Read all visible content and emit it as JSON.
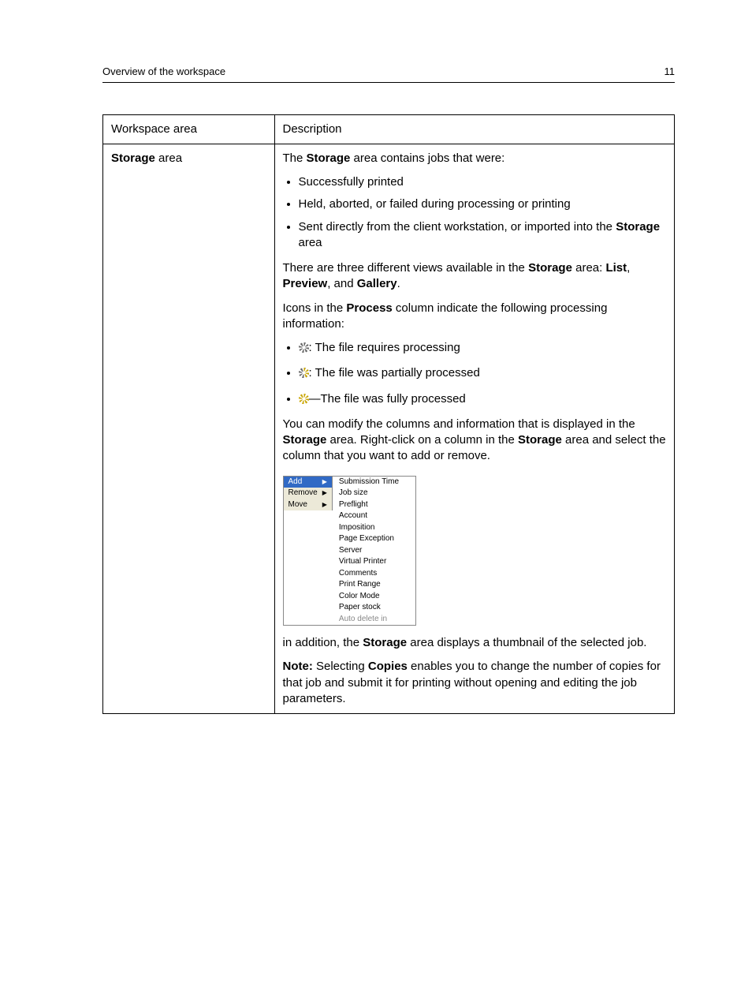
{
  "header": {
    "title": "Overview of the workspace",
    "page_no": "11"
  },
  "table": {
    "head": {
      "c1": "Workspace area",
      "c2": "Description"
    },
    "ws_label_bold": "Storage",
    "ws_label_rest": " area",
    "intro_a": "The ",
    "intro_b": "Storage",
    "intro_c": " area contains jobs that were:",
    "bul1": "Successfully printed",
    "bul2": "Held, aborted, or failed during processing or printing",
    "bul3_a": "Sent directly from the client workstation, or imported into the ",
    "bul3_b": "Storage",
    "bul3_c": " area",
    "views_a": "There are three different views available in the ",
    "views_b": "Storage",
    "views_c": " area: ",
    "views_d": "List",
    "views_e": ", ",
    "views_f": "Preview",
    "views_g": ", and ",
    "views_h": "Gallery",
    "views_i": ".",
    "proc_a": "Icons in the ",
    "proc_b": "Process",
    "proc_c": " column indicate the following processing information:",
    "ic1": ": The file requires processing",
    "ic2": ": The file was partially processed",
    "ic3": "—The file was fully processed",
    "mod_a": "You can modify the columns and information that is displayed in the ",
    "mod_b": "Storage",
    "mod_c": " area. Right-click on a column in the ",
    "mod_d": "Storage",
    "mod_e": " area and select the column that you want to add or remove.",
    "addl_a": "in addition, the ",
    "addl_b": "Storage",
    "addl_c": " area displays a thumbnail of the selected job.",
    "note_a": "Note:",
    "note_b": " Selecting ",
    "note_c": "Copies",
    "note_d": " enables you to change the number of copies for that job and submit it for printing without opening and editing the job parameters."
  },
  "menu": {
    "left": [
      "Add",
      "Remove",
      "Move"
    ],
    "right": [
      "Submission Time",
      "Job size",
      "Preflight",
      "Account",
      "Imposition",
      "Page Exception",
      "Server",
      "Virtual Printer",
      "Comments",
      "Print Range",
      "Color Mode",
      "Paper stock",
      "Auto delete in"
    ]
  }
}
